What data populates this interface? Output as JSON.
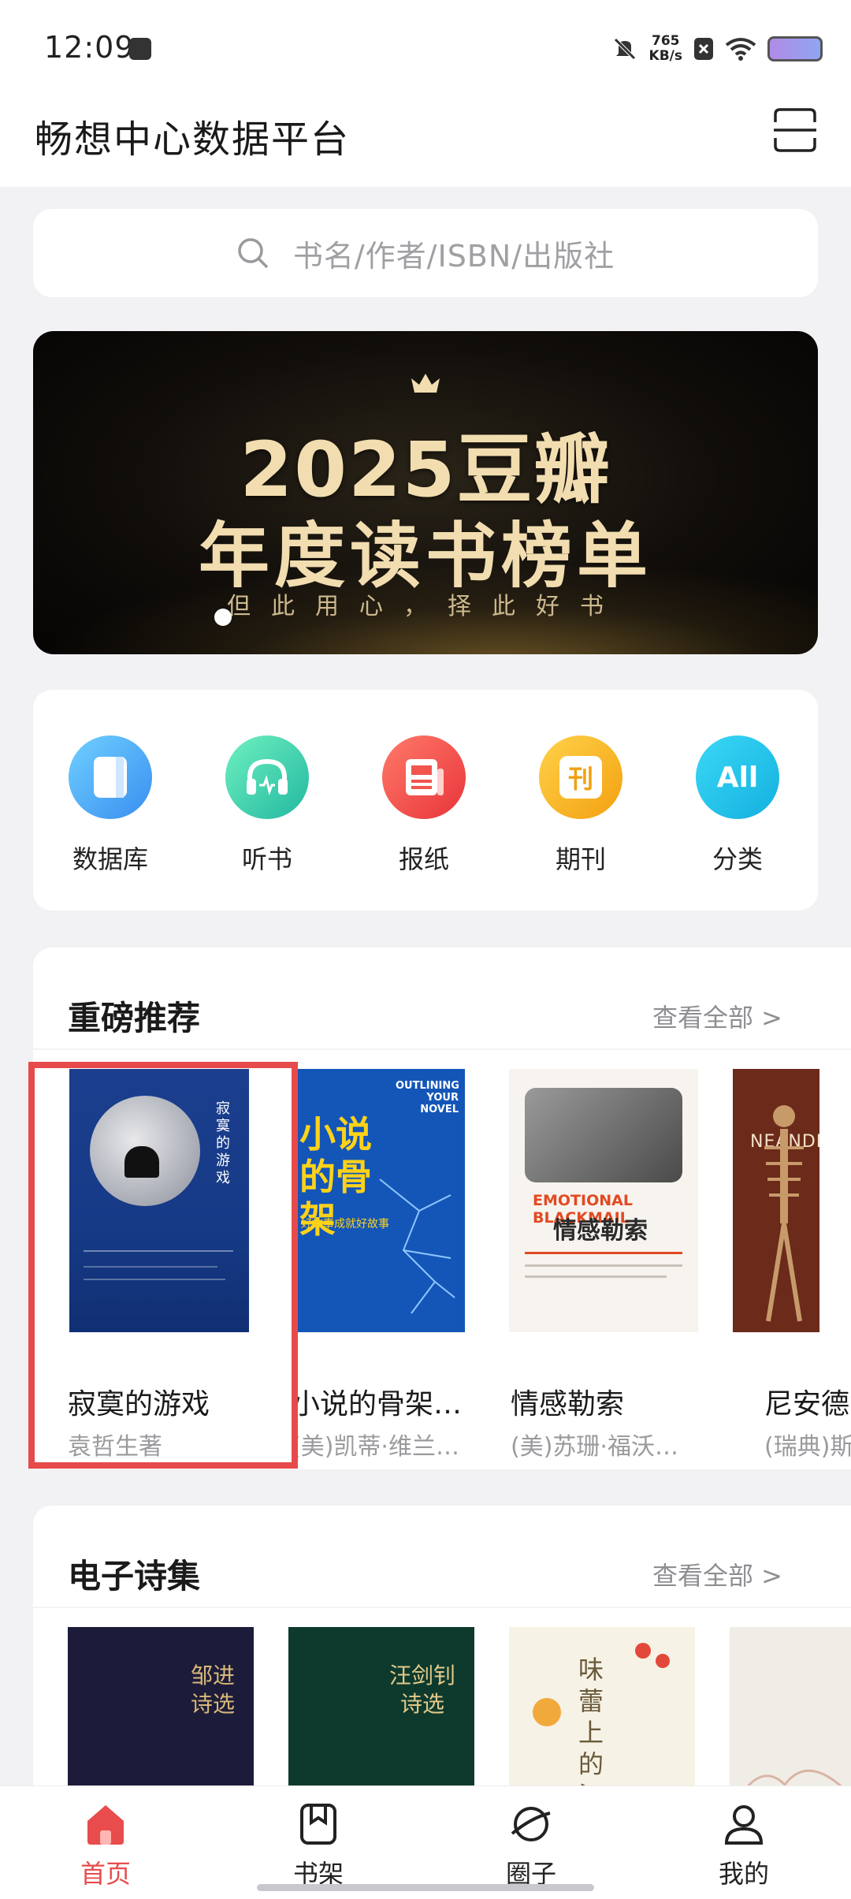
{
  "status": {
    "time": "12:09",
    "speed_value": "765",
    "speed_unit": "KB/s"
  },
  "header": {
    "title": "畅想中心数据平台"
  },
  "search": {
    "placeholder": "书名/作者/ISBN/出版社"
  },
  "banner": {
    "line1": "2025豆瓣",
    "line2": "年度读书榜单",
    "subtitle": "但此用心，择此好书"
  },
  "categories": [
    {
      "label": "数据库",
      "icon": "database-icon",
      "color": "#4fb3f5"
    },
    {
      "label": "听书",
      "icon": "headphones-icon",
      "color": "#3fd3a8"
    },
    {
      "label": "报纸",
      "icon": "newspaper-icon",
      "color": "#f2544e"
    },
    {
      "label": "期刊",
      "icon": "journal-icon",
      "glyph": "刊",
      "color": "#f7b41e"
    },
    {
      "label": "分类",
      "icon": "category-icon",
      "glyph": "All",
      "color": "#21c6e6"
    }
  ],
  "featured": {
    "title": "重磅推荐",
    "more": "查看全部 >",
    "books": [
      {
        "title": "寂寞的游戏",
        "author": "袁哲生著"
      },
      {
        "title": "小说的骨架…",
        "author": "(美)凯蒂·维兰…"
      },
      {
        "title": "情感勒索",
        "author": "(美)苏珊·福沃…"
      },
      {
        "title": "尼安德",
        "author": "(瑞典)斯"
      }
    ]
  },
  "poetry": {
    "title": "电子诗集",
    "more": "查看全部 >",
    "covers": [
      {
        "text1": "邹进",
        "text2": "诗选"
      },
      {
        "text1": "汪剑钊",
        "text2": "诗选"
      },
      {
        "text1": "味蕾上的江南"
      }
    ]
  },
  "book_covers": {
    "b1": {
      "vertical": "寂寞的游戏"
    },
    "b2": {
      "big": "小说的骨架",
      "eng": "OUTLINING YOUR NOVEL",
      "tag": "好故事成就好故事"
    },
    "b3": {
      "eng": "EMOTIONAL BLACKMAIL",
      "cn": "情感勒索"
    },
    "b4": {
      "eng": "NEANDE"
    }
  },
  "nav": [
    {
      "label": "首页",
      "icon": "home-icon",
      "active": true
    },
    {
      "label": "书架",
      "icon": "bookshelf-icon"
    },
    {
      "label": "圈子",
      "icon": "planet-icon"
    },
    {
      "label": "我的",
      "icon": "profile-icon"
    }
  ],
  "colors": {
    "accent": "#e84c4c",
    "highlight_border": "#e64a4a"
  }
}
